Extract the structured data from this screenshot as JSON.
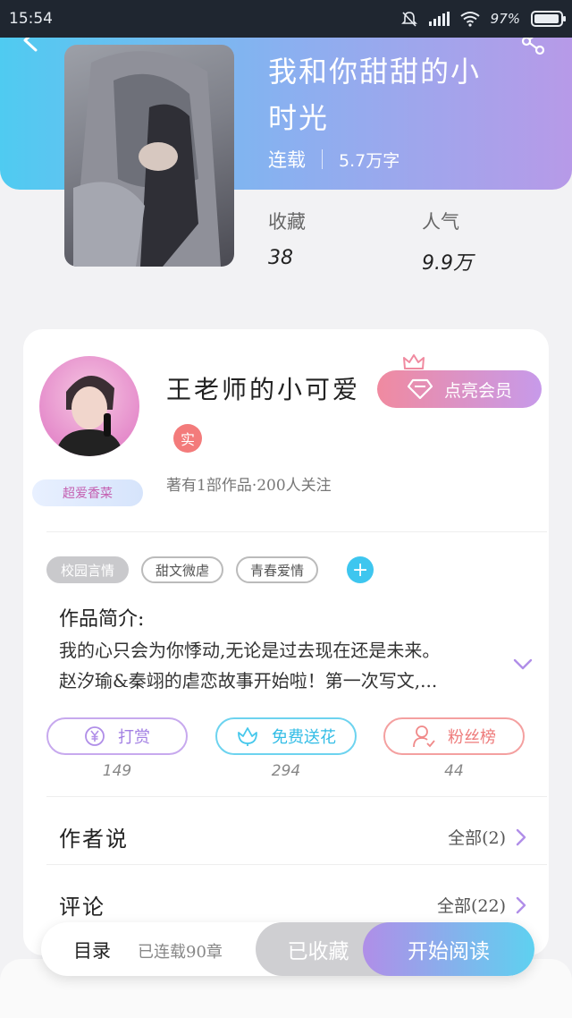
{
  "status_bar": {
    "time": "15:54",
    "battery": "97%",
    "battery_level": 0.97
  },
  "colors": {
    "hero_gradient": [
      "#4fcbf1",
      "#b79ae8"
    ],
    "accent_blue": "#3ec6ef",
    "accent_purple": "#b08ee8",
    "reward": "#b08ee8",
    "flower": "#46c8ec",
    "fans": "#f08a8a"
  },
  "book": {
    "title_line1": "我和你甜甜的小",
    "title_line2": "时光",
    "status": "连载",
    "word_count": "5.7万字",
    "collect_label": "收藏",
    "collect_value": "38",
    "popularity_label": "人气",
    "popularity_value": "9.9万"
  },
  "author": {
    "name": "王老师的小可爱",
    "verified_badge": "实",
    "member_button": "点亮会员",
    "works_info": "著有1部作品·200人关注",
    "badge": "超爱香菜"
  },
  "tags": [
    "校园言情",
    "甜文微虐",
    "青春爱情"
  ],
  "intro": {
    "title": "作品简介:",
    "line1": "我的心只会为你悸动,无论是过去现在还是未来。",
    "line2": "赵汐瑜&秦翊的虐恋故事开始啦！第一次写文,..."
  },
  "actions": [
    {
      "label": "打赏",
      "count": "149"
    },
    {
      "label": "免费送花",
      "count": "294"
    },
    {
      "label": "粉丝榜",
      "count": "44"
    }
  ],
  "sections": {
    "author_says": {
      "title": "作者说",
      "link": "全部(2)"
    },
    "comments": {
      "title": "评论",
      "link": "全部(22)"
    }
  },
  "bottom_bar": {
    "toc": "目录",
    "progress": "已连载90章",
    "collected": "已收藏",
    "read": "开始阅读"
  }
}
